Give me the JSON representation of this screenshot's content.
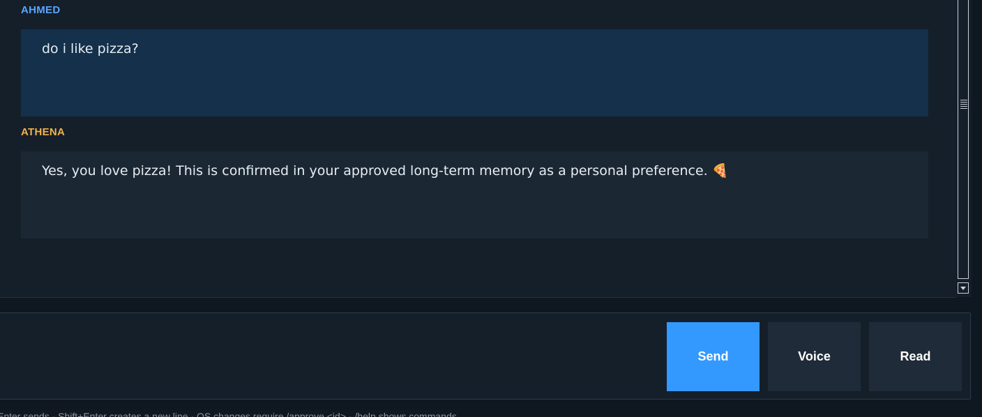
{
  "conversation": {
    "messages": [
      {
        "sender": "AHMED",
        "text": "do i like pizza?"
      },
      {
        "sender": "ATHENA",
        "text": "Yes, you love pizza! This is confirmed in your approved long-term memory as a personal preference. 🍕"
      }
    ]
  },
  "composer": {
    "input_value": "",
    "send_label": "Send",
    "voice_label": "Voice",
    "read_label": "Read"
  },
  "footer": {
    "hint": "Enter sends · Shift+Enter creates a new line · OS changes require /approve <id> · /help shows commands"
  },
  "colors": {
    "user_name": "#58a6ff",
    "assistant_name": "#f2b24b",
    "send_button": "#3399ff"
  }
}
